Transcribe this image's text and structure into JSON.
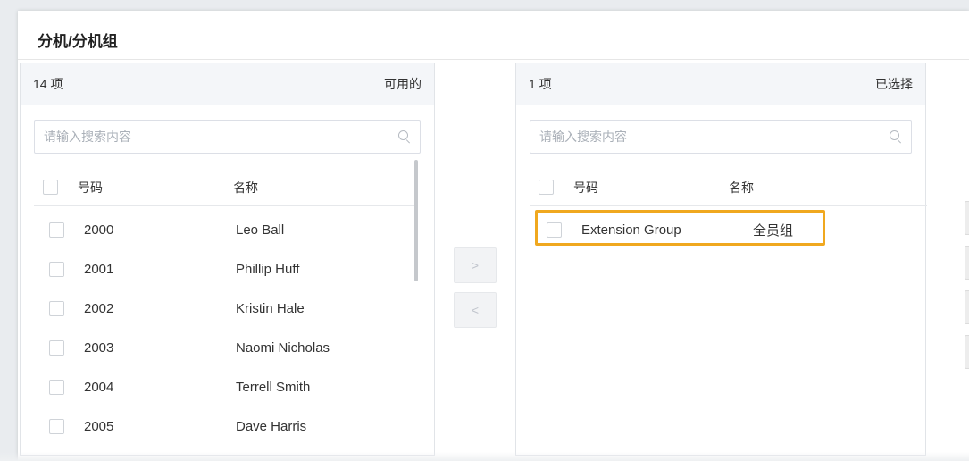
{
  "section_title": "分机/分机组",
  "available": {
    "count_label": "14 项",
    "panel_label": "可用的",
    "search_placeholder": "请输入搜索内容",
    "col_number": "号码",
    "col_name": "名称",
    "rows": [
      {
        "number": "2000",
        "name": "Leo Ball"
      },
      {
        "number": "2001",
        "name": "Phillip Huff"
      },
      {
        "number": "2002",
        "name": "Kristin Hale"
      },
      {
        "number": "2003",
        "name": "Naomi Nicholas"
      },
      {
        "number": "2004",
        "name": "Terrell Smith"
      },
      {
        "number": "2005",
        "name": "Dave Harris"
      }
    ]
  },
  "selected": {
    "count_label": "1 项",
    "panel_label": "已选择",
    "search_placeholder": "请输入搜索内容",
    "col_number": "号码",
    "col_name": "名称",
    "rows": [
      {
        "number": "Extension Group",
        "name": "全员组"
      }
    ]
  },
  "transfer": {
    "move_right_glyph": ">",
    "move_left_glyph": "<"
  },
  "colors": {
    "highlight": "#f0a81f",
    "header_bg": "#f4f6f9"
  },
  "icons": [
    "search-icon",
    "chevron-right-icon",
    "chevron-left-icon"
  ]
}
